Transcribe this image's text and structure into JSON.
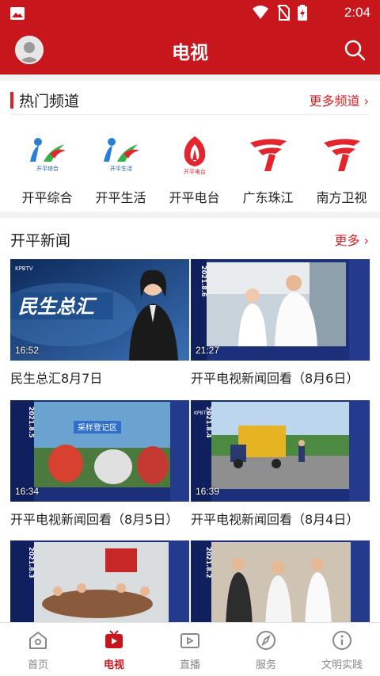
{
  "status": {
    "time": "2:04"
  },
  "header": {
    "title": "电视",
    "avatar": "avatar",
    "search_icon": "search-icon"
  },
  "hot": {
    "title": "热门频道",
    "more": "更多频道 ›",
    "channels": [
      {
        "label": "开平综合",
        "logo_text": "开平综合",
        "icon": "kaiping-logo"
      },
      {
        "label": "开平生活",
        "logo_text": "开平生活",
        "icon": "kaiping-logo"
      },
      {
        "label": "开平电台",
        "logo_text": "开平电台",
        "icon": "radio-logo"
      },
      {
        "label": "广东珠江",
        "logo_text": "",
        "icon": "gdtv-logo"
      },
      {
        "label": "南方卫视",
        "logo_text": "",
        "icon": "gdtv-logo"
      }
    ]
  },
  "news": {
    "title": "开平新闻",
    "more": "更多 ›",
    "items": [
      {
        "title": "民生总汇8月7日",
        "duration": "16:52",
        "overlay": "民生总汇",
        "tag": "KPBTV"
      },
      {
        "title": "开平电视新闻回看（8月6日）",
        "duration": "21:27",
        "date_tag": "2021.8.6"
      },
      {
        "title": "开平电视新闻回看（8月5日）",
        "duration": "16:34",
        "date_tag": "2021.8.5",
        "banner": "采样登记区"
      },
      {
        "title": "开平电视新闻回看（8月4日）",
        "duration": "16:39",
        "date_tag": "2021.8.4",
        "tag": "KPBTV"
      },
      {
        "title": "",
        "duration": "",
        "date_tag": "2021.8.3"
      },
      {
        "title": "",
        "duration": "",
        "date_tag": "2021.8.2"
      }
    ]
  },
  "tabs": [
    {
      "label": "首页",
      "icon": "home-icon",
      "active": false
    },
    {
      "label": "电视",
      "icon": "tv-icon",
      "active": true
    },
    {
      "label": "直播",
      "icon": "live-icon",
      "active": false
    },
    {
      "label": "服务",
      "icon": "compass-icon",
      "active": false
    },
    {
      "label": "文明实践",
      "icon": "info-icon",
      "active": false
    }
  ],
  "colors": {
    "brand": "#c8161d",
    "accent": "#d8232a"
  }
}
